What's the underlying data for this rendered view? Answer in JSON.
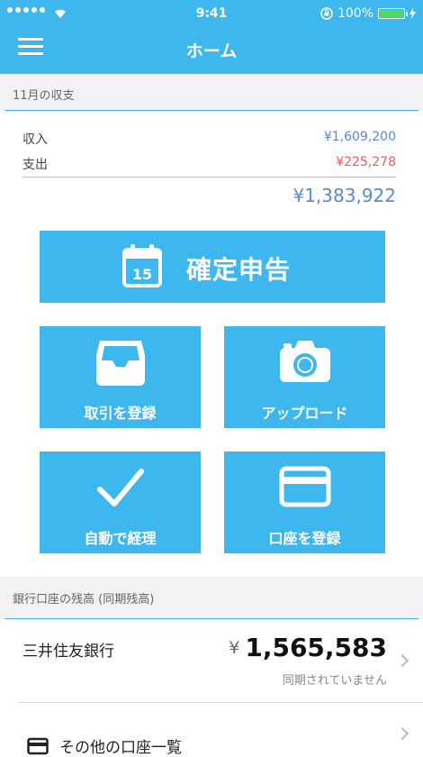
{
  "status_bar": {
    "time": "9:41",
    "battery": "100%"
  },
  "header": {
    "title": "ホーム",
    "menu_icon": "hamburger-icon"
  },
  "summary": {
    "section_label": "11月の収支",
    "income_label": "収入",
    "income_value": "¥1,609,200",
    "expense_label": "支出",
    "expense_value": "¥225,278",
    "net_value": "¥1,383,922",
    "colors": {
      "income": "#5a8ad0",
      "expense": "#f05a5a",
      "accent": "#3eb7ee"
    }
  },
  "actions": {
    "tax_return": {
      "label": "確定申告",
      "icon": "calendar-icon",
      "calendar_day": "15"
    },
    "register_transaction": {
      "label": "取引を登録",
      "icon": "inbox-tray-icon"
    },
    "upload": {
      "label": "アップロード",
      "icon": "camera-icon"
    },
    "auto_bookkeeping": {
      "label": "自動で経理",
      "icon": "checkmark-icon"
    },
    "register_account": {
      "label": "口座を登録",
      "icon": "credit-card-icon"
    }
  },
  "bank": {
    "section_label": "銀行口座の残高 (同期残高)",
    "name": "三井住友銀行",
    "currency": "¥",
    "amount": "1,565,583",
    "sync_status": "同期されていません",
    "other_accounts": "その他の口座一覧"
  }
}
